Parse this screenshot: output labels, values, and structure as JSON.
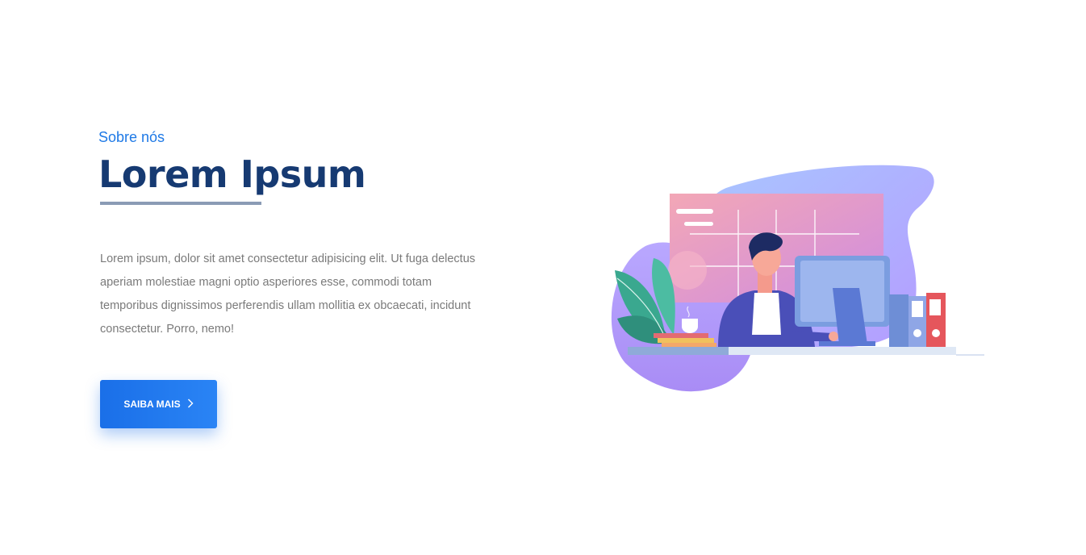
{
  "about": {
    "eyebrow": "Sobre nós",
    "title": "Lorem Ipsum",
    "paragraph": "Lorem ipsum, dolor sit amet consectetur adipisicing elit. Ut fuga delectus aperiam molestiae magni optio asperiores esse, commodi totam temporibus dignissimos perferendis ullam mollitia ex obcaecati, incidunt consectetur. Porro, nemo!",
    "cta_label": "SAIBA MAIS",
    "cta_icon": "chevron-right-icon"
  },
  "colors": {
    "accent": "#1e79e6",
    "title": "#163a72",
    "button": "#1a6fe8",
    "text": "#7a7a7a"
  },
  "illustration": {
    "subject": "person-working-at-computer-illustration"
  }
}
